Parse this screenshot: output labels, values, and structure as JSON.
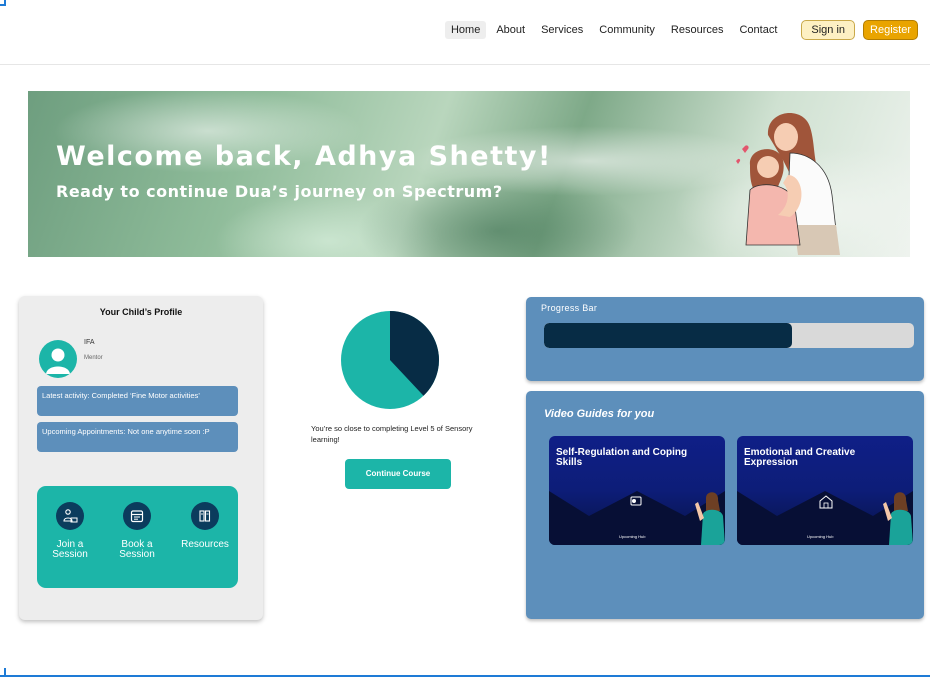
{
  "nav": {
    "links": [
      "Home",
      "About",
      "Services",
      "Community",
      "Resources",
      "Contact"
    ],
    "signin_label": "Sign in",
    "register_label": "Register"
  },
  "hero": {
    "title": "Welcome back, Adhya Shetty!",
    "subtitle": "Ready to continue Dua’s journey on Spectrum?"
  },
  "profile": {
    "title": "Your Child’s Profile",
    "mentor_name": "IFA",
    "mentor_role": "Mentor",
    "latest_activity": "Latest activity: Completed ‘Fine Motor activities’",
    "appointments": "Upcoming Appointments: Not one anytime soon :P",
    "actions": [
      {
        "label": "Join a Session",
        "icon": "session-person-icon"
      },
      {
        "label": "Book a Session",
        "icon": "calendar-icon"
      },
      {
        "label": "Resources",
        "icon": "books-icon"
      }
    ]
  },
  "level": {
    "message": "You’re so close to completing Level 5 of Sensory learning!",
    "continue_label": "Continue Course",
    "completion_fraction": 0.38
  },
  "progress": {
    "label": "Progress Bar",
    "fraction": 0.67
  },
  "videos": {
    "heading": "Video Guides for you",
    "items": [
      {
        "title": "Self-Regulation and Coping Skills",
        "brand": "Upcoming Hub"
      },
      {
        "title": "Emotional and Creative Expression",
        "brand": "Upcoming Hub"
      }
    ]
  },
  "colors": {
    "teal": "#1cb5a8",
    "navy": "#072c45",
    "card_blue": "#5d8fbb",
    "register": "#e9a400"
  }
}
